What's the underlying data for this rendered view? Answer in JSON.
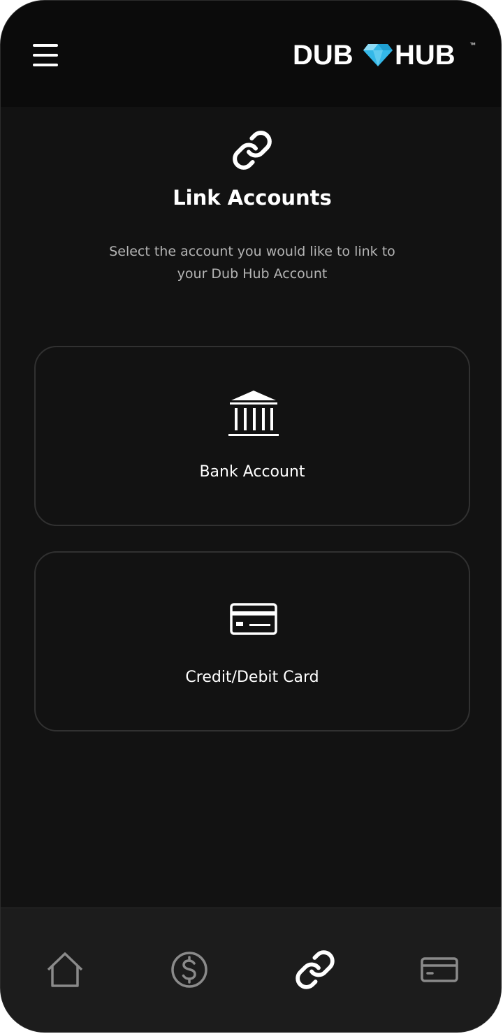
{
  "colors": {
    "background": "#121212",
    "header_background": "#0b0b0b",
    "nav_background": "#1c1c1c",
    "card_border": "#313131",
    "text_primary": "#ffffff",
    "text_secondary": "#b5b5b5",
    "nav_inactive": "#8a8a8a",
    "nav_active": "#ffffff",
    "logo_gem": "#34b8e8"
  },
  "header": {
    "menu_icon": "hamburger-menu-icon",
    "logo_left": "DUB",
    "logo_right": "HUB",
    "logo_tm": "™"
  },
  "main": {
    "icon": "link-icon",
    "title": "Link Accounts",
    "subtitle": "Select the account you would like to link to your Dub Hub Account"
  },
  "options": [
    {
      "icon": "bank-icon",
      "label": "Bank Account"
    },
    {
      "icon": "credit-card-icon",
      "label": "Credit/Debit Card"
    }
  ],
  "bottom_nav": {
    "items": [
      {
        "icon": "home-icon",
        "active": false
      },
      {
        "icon": "dollar-icon",
        "active": false
      },
      {
        "icon": "link-icon",
        "active": true
      },
      {
        "icon": "card-icon",
        "active": false
      }
    ]
  }
}
